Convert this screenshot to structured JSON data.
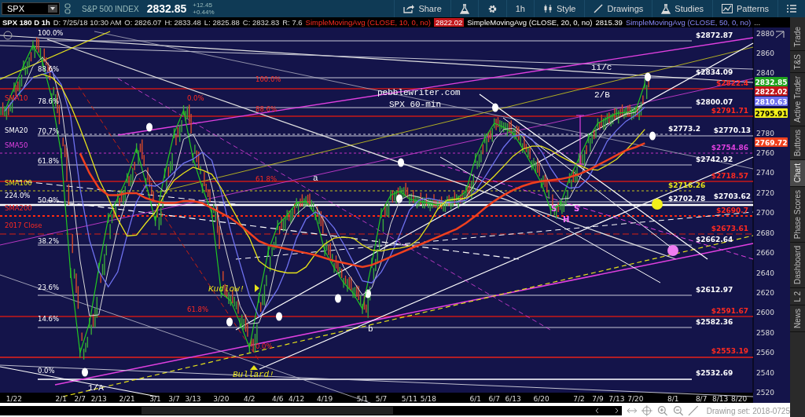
{
  "toolbar": {
    "symbol": "SPX",
    "description": "S&P 500 INDEX",
    "last": "2832.85",
    "change": "+12.45",
    "change_pct": "+0.44%",
    "buttons": [
      {
        "kind": "share",
        "label": "Share"
      },
      {
        "kind": "flask"
      },
      {
        "kind": "gear"
      },
      {
        "kind": "text",
        "label": "1h"
      },
      {
        "kind": "style",
        "label": "Style"
      },
      {
        "kind": "line",
        "label": "Drawings"
      },
      {
        "kind": "flask",
        "label": "Studies"
      },
      {
        "kind": "patterns",
        "label": "Patterns"
      },
      {
        "kind": "menu"
      }
    ]
  },
  "info_bar": {
    "title": "SPX 180 D 1h",
    "fields": [
      "D: 7/25/18 10:30 AM",
      "O: 2826.07",
      "H: 2833.48",
      "L: 2825.88",
      "C: 2832.83",
      "R: 7.6"
    ],
    "studies": [
      {
        "name": "SimpleMovingAvg (CLOSE, 10, 0, no)",
        "value": "2822.02",
        "kind": "sma10"
      },
      {
        "name": "SimpleMovingAvg (CLOSE, 20, 0, no)",
        "value": "2815.39",
        "kind": "sma20"
      },
      {
        "name": "SimpleMovingAvg (CLOSE, 50, 0, no)",
        "kind": "sma50"
      }
    ],
    "more": "..."
  },
  "chart": {
    "chart_data": {
      "type": "line",
      "categories": [
        null,
        "1/22",
        null,
        null,
        null,
        null,
        "2/1",
        null,
        "2/7",
        null,
        "2/13",
        null,
        null,
        "2/21",
        null,
        null,
        "3/1",
        null,
        "3/7",
        null,
        "3/13",
        null,
        null,
        "3/20",
        null,
        null,
        "4/2",
        null,
        null,
        "4/6",
        null,
        "4/12",
        null,
        null,
        "4/19",
        null,
        null,
        null,
        "5/1",
        null,
        "5/7",
        null,
        null,
        "5/11",
        null,
        "5/18",
        null,
        null,
        null,
        null,
        "6/1",
        null,
        "6/7",
        null,
        "6/13",
        null,
        null,
        "6/20",
        null,
        null,
        null,
        "7/2",
        null,
        "7/9",
        null,
        "7/13",
        null,
        "7/20",
        null,
        null,
        null,
        "8/1",
        null,
        null,
        "8/7",
        null,
        "8/13",
        null,
        "8/20",
        null
      ],
      "ylim": [
        2520,
        2886
      ],
      "yticks": [
        2880,
        2860,
        2840,
        2780,
        2760,
        2740,
        2720,
        2700,
        2680,
        2660,
        2640,
        2620,
        2600,
        2580,
        2560,
        2540,
        2520
      ],
      "series": [
        {
          "color": "#22c822",
          "values": [
            2802,
            2826,
            2848,
            2868,
            2852,
            2815,
            2760,
            2640,
            2560,
            2590,
            2645,
            2695,
            2715,
            2735,
            2765,
            2730,
            2692,
            2740,
            2780,
            2803,
            2755,
            2725,
            2700,
            2620,
            2612,
            2590,
            2565,
            2615,
            2662,
            2688,
            2698,
            2710,
            2712,
            2698,
            2662,
            2645,
            2630,
            2620,
            2604,
            2650,
            2700,
            2718,
            2722,
            2714,
            2712,
            2710,
            2708,
            2712,
            2714,
            2722,
            2755,
            2775,
            2790,
            2786,
            2780,
            2765,
            2748,
            2730,
            2703,
            2708,
            2735,
            2755,
            2775,
            2790,
            2795,
            2800,
            2801,
            2802,
            2830,
            null,
            null,
            null,
            null,
            null,
            null,
            null,
            null,
            null,
            null,
            null
          ]
        },
        {
          "color": "#d8d8d8",
          "values": [
            null,
            null,
            2825,
            2847,
            2856,
            2845,
            2809,
            2738,
            2653,
            2597,
            2598,
            2643,
            2685,
            2715,
            2738,
            2743,
            2729,
            2721,
            2737,
            2774,
            2779,
            2761,
            2727,
            2682,
            2644,
            2607,
            2589,
            2590,
            2614,
            2655,
            2683,
            2699,
            2707,
            2707,
            2691,
            2668,
            2646,
            2632,
            2618,
            2625,
            2651,
            2689,
            2713,
            2718,
            2716,
            2712,
            2710,
            2710,
            2711,
            2716,
            2730,
            2751,
            2773,
            2784,
            2785,
            2777,
            2764,
            2748,
            2727,
            2714,
            2715,
            2733,
            2755,
            2773,
            2787,
            2795,
            2799,
            2801,
            2811,
            null,
            null,
            null,
            null,
            null,
            null,
            null,
            null,
            null,
            null,
            null
          ]
        },
        {
          "color": "#6f72f0",
          "values": [
            2802,
            2814,
            2825,
            2836,
            2839,
            2842,
            2829,
            2797,
            2725,
            2673,
            2642,
            2626,
            2641,
            2678,
            2711,
            2728,
            2727,
            2732,
            2741,
            2750,
            2754,
            2761,
            2753,
            2721,
            2682,
            2649,
            2617,
            2596,
            2609,
            2624,
            2646,
            2675,
            2694,
            2701,
            2696,
            2685,
            2669,
            2651,
            2632,
            2630,
            2641,
            2658,
            2679,
            2703,
            2713,
            2715,
            2713,
            2711,
            2711,
            2713,
            2722,
            2736,
            2751,
            2766,
            2777,
            2779,
            2774,
            2762,
            2745,
            2731,
            2725,
            2726,
            2735,
            2753,
            2772,
            2783,
            2792,
            2798,
            2806,
            null,
            null,
            null,
            null,
            null,
            null,
            null,
            null,
            null,
            null,
            null
          ]
        },
        {
          "color": "#e6e21a",
          "values": [
            null,
            null,
            null,
            2836,
            2839,
            2836,
            2827,
            2808,
            2785,
            2760,
            2734,
            2715,
            2694,
            2677,
            2678,
            2690,
            2701,
            2719,
            2733,
            2740,
            2746,
            2743,
            2739,
            2725,
            2707,
            2690,
            2675,
            2652,
            2645,
            2642,
            2640,
            2640,
            2646,
            2659,
            2669,
            2675,
            2676,
            2675,
            2668,
            2663,
            2662,
            2664,
            2665,
            2667,
            2674,
            2688,
            2704,
            2713,
            2714,
            2715,
            2720,
            2728,
            2737,
            2747,
            2757,
            2764,
            2767,
            2767,
            2763,
            2757,
            2752,
            2748,
            2744,
            2743,
            2748,
            2754,
            2763,
            2773,
            2784,
            null,
            null,
            null,
            null,
            null,
            null,
            null,
            null,
            null,
            null,
            null
          ]
        },
        {
          "color": "#f0401e",
          "values": [
            null,
            null,
            null,
            null,
            null,
            null,
            null,
            null,
            2760,
            2740,
            2725,
            2718,
            2718,
            2720,
            2720,
            2715,
            2712,
            2710,
            2710,
            2712,
            2712,
            2710,
            2705,
            2700,
            2695,
            2688,
            2680,
            2672,
            2668,
            2666,
            2664,
            2662,
            2660,
            2658,
            2655,
            2652,
            2650,
            2648,
            2646,
            2648,
            2652,
            2656,
            2660,
            2664,
            2668,
            2672,
            2676,
            2680,
            2684,
            2690,
            2697,
            2705,
            2712,
            2718,
            2723,
            2727,
            2730,
            2732,
            2733,
            2734,
            2736,
            2739,
            2743,
            2748,
            2753,
            2758,
            2763,
            2766,
            2770,
            null,
            null,
            null,
            null,
            null,
            null,
            null,
            null,
            null,
            null,
            null
          ]
        }
      ]
    },
    "price_tags": [
      {
        "text": "2832.85",
        "color": "#1fa31f"
      },
      {
        "text": "2822.02",
        "color": "#c2161b"
      },
      {
        "text": "2810.63",
        "color": "#6f72f0"
      },
      {
        "text": "2795.91",
        "color": "#f2ef1a"
      },
      {
        "text": "2769.72",
        "color": "#f0401e"
      }
    ],
    "level_labels": [
      {
        "text": "$2872.87",
        "kind": "plain"
      },
      {
        "text": "$2834.09",
        "kind": "plain"
      },
      {
        "text": "$2822.4",
        "kind": "marked"
      },
      {
        "text": "$2800.07",
        "kind": "plain"
      },
      {
        "text": "$2791.71",
        "kind": "marked"
      },
      {
        "text": "$2773.2",
        "kind": "plain"
      },
      {
        "text": "$2770.13",
        "kind": "plain"
      },
      {
        "text": "$2754.86",
        "kind": "sma50"
      },
      {
        "text": "$2742.92",
        "kind": "plain"
      },
      {
        "text": "$2718.57",
        "kind": "marked"
      },
      {
        "text": "$2716.26",
        "kind": "sma100"
      },
      {
        "text": "$2703.62",
        "kind": "plain"
      },
      {
        "text": "$2702.78",
        "kind": "plain"
      },
      {
        "text": "$2690.7",
        "kind": "marked"
      },
      {
        "text": "$2673.61",
        "kind": "marked"
      },
      {
        "text": "$2662.64",
        "kind": "plain"
      },
      {
        "text": "$2612.97",
        "kind": "plain"
      },
      {
        "text": "$2591.67",
        "kind": "marked"
      },
      {
        "text": "$2582.36",
        "kind": "plain"
      },
      {
        "text": "$2553.19",
        "kind": "marked"
      },
      {
        "text": "$2532.69",
        "kind": "plain"
      }
    ],
    "left_labels": [
      {
        "text": "100.0%",
        "kind": "plain"
      },
      {
        "text": "88.6%",
        "kind": "plain"
      },
      {
        "text": "78.6%",
        "kind": "plain"
      },
      {
        "text": "70.7%",
        "kind": "plain"
      },
      {
        "text": "61.8%",
        "kind": "plain"
      },
      {
        "text": "50.0%",
        "kind": "plain"
      },
      {
        "text": "38.2%",
        "kind": "plain"
      },
      {
        "text": "23.6%",
        "kind": "plain"
      },
      {
        "text": "14.6%",
        "kind": "plain"
      },
      {
        "text": "0.0%",
        "kind": "plain"
      },
      {
        "text": "SMA10",
        "kind": "marked"
      },
      {
        "text": "SMA20",
        "kind": "plain"
      },
      {
        "text": "SMA50",
        "kind": "sma50"
      },
      {
        "text": "SMA100",
        "kind": "sma100"
      },
      {
        "text": "224.0%",
        "kind": "plain"
      },
      {
        "text": "SMA200",
        "kind": "marked"
      },
      {
        "text": "2017 Close",
        "kind": "marked"
      },
      {
        "text": "100.0%",
        "kind": "marked"
      },
      {
        "text": "88.6%",
        "kind": "marked"
      },
      {
        "text": "0.0%",
        "kind": "marked"
      },
      {
        "text": "61.8%",
        "kind": "marked"
      },
      {
        "text": "61.8%",
        "kind": "marked"
      },
      {
        "text": "0.0%",
        "kind": "marked"
      }
    ],
    "annotations": [
      {
        "text": "ii/c",
        "kind": "wave"
      },
      {
        "text": "2/B",
        "kind": "wave"
      },
      {
        "text": "pebblewriter.com",
        "kind": "wave"
      },
      {
        "text": "SPX 60-min",
        "kind": "wave"
      },
      {
        "text": "a",
        "kind": "wave"
      },
      {
        "text": "b",
        "kind": "wave"
      },
      {
        "text": "1/A",
        "kind": "wave"
      },
      {
        "text": "Kudlow!",
        "kind": "event"
      },
      {
        "text": "Bullard!",
        "kind": "event"
      },
      {
        "text": "S",
        "kind": "pattern"
      },
      {
        "text": "H",
        "kind": "pattern"
      },
      {
        "text": "S",
        "kind": "pattern"
      }
    ]
  },
  "side_tabs": [
    {
      "label": "Trade",
      "selected": false
    },
    {
      "label": "T&S",
      "selected": false
    },
    {
      "label": "Active Trader",
      "selected": false
    },
    {
      "label": "Buttons",
      "selected": false
    },
    {
      "label": "Chart",
      "selected": true
    },
    {
      "label": "Phase Scores",
      "selected": false
    },
    {
      "label": "Dashboard",
      "selected": false
    },
    {
      "label": "L 2",
      "selected": false
    },
    {
      "label": "News",
      "selected": false
    }
  ],
  "bottom_bar": {
    "drawing_set": "Drawing set: 2018-0725"
  }
}
